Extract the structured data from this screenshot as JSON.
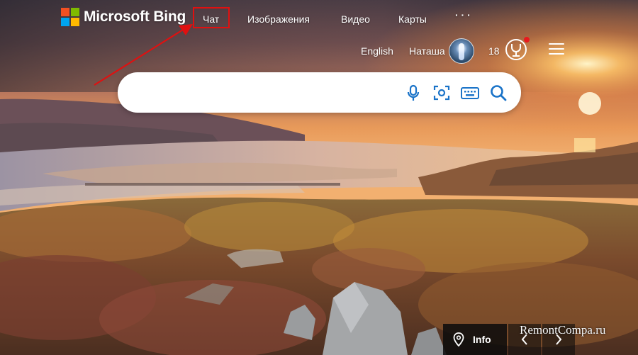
{
  "brand": {
    "name": "Microsoft Bing",
    "logo_colors": [
      "#f25022",
      "#7fba00",
      "#00a4ef",
      "#ffb900"
    ]
  },
  "nav": {
    "items": [
      "Чат",
      "Изображения",
      "Видео",
      "Карты"
    ],
    "more_label": "· · ·"
  },
  "topbar": {
    "language": "English",
    "user_name": "Наташа",
    "rewards_points": "18"
  },
  "search": {
    "value": "",
    "placeholder": "",
    "accent_color": "#1a73c8",
    "icons": [
      "microphone-icon",
      "visual-search-icon",
      "keyboard-icon",
      "search-icon"
    ]
  },
  "bottom": {
    "info_label": "Info"
  },
  "watermark": "RemontCompa.ru",
  "annotation_color": "#e01010"
}
